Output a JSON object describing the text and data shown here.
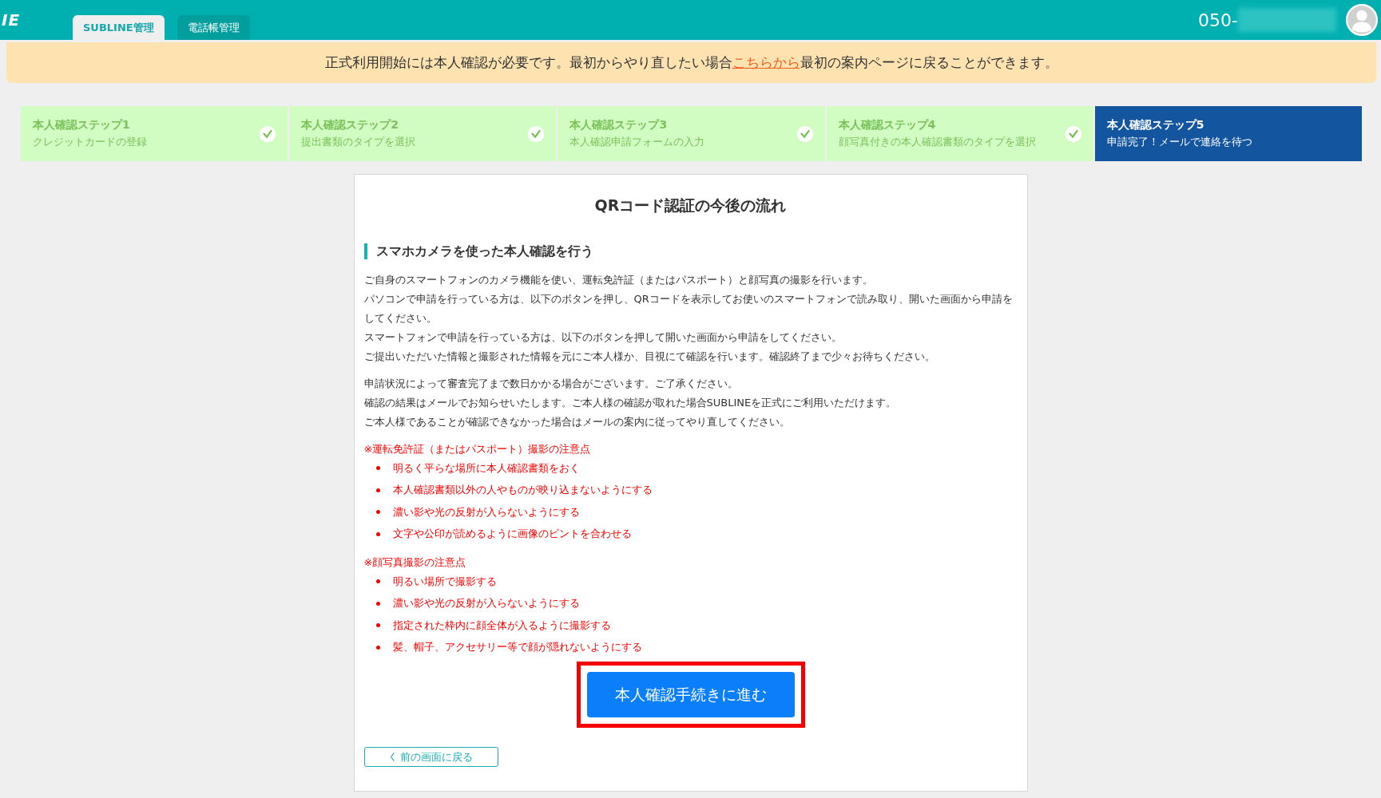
{
  "header": {
    "logo_text": "IE",
    "tabs": [
      {
        "label": "SUBLINE管理",
        "selected": true
      },
      {
        "label": "電話帳管理",
        "selected": false
      }
    ],
    "phone_number": "050-"
  },
  "notice": {
    "before": "正式利用開始には本人確認が必要です。最初からやり直したい場合",
    "link": "こちらから",
    "after": "最初の案内ページに戻ることができます。"
  },
  "steps": [
    {
      "title": "本人確認ステップ1",
      "subtitle": "クレジットカードの登録",
      "done": true,
      "selected": false
    },
    {
      "title": "本人確認ステップ2",
      "subtitle": "提出書類のタイプを選択",
      "done": true,
      "selected": false
    },
    {
      "title": "本人確認ステップ3",
      "subtitle": "本人確認申請フォームの入力",
      "done": true,
      "selected": false
    },
    {
      "title": "本人確認ステップ4",
      "subtitle": "顔写真付きの本人確認書類のタイプを選択",
      "done": true,
      "selected": false
    },
    {
      "title": "本人確認ステップ5",
      "subtitle": "申請完了！メールで連絡を待つ",
      "done": false,
      "selected": true
    }
  ],
  "card": {
    "title": "QRコード認証の今後の流れ",
    "section_heading": "スマホカメラを使った本人確認を行う",
    "paragraphs": [
      [
        "ご自身のスマートフォンのカメラ機能を使い、運転免許証（またはパスポート）と顔写真の撮影を行います。",
        "パソコンで申請を行っている方は、以下のボタンを押し、QRコードを表示してお使いのスマートフォンで読み取り、開いた画面から申請をしてください。",
        "スマートフォンで申請を行っている方は、以下のボタンを押して開いた画面から申請をしてください。",
        "ご提出いただいた情報と撮影された情報を元にご本人様か、目視にて確認を行います。確認終了まで少々お待ちください。"
      ],
      [
        "申請状況によって審査完了まで数日かかる場合がございます。ご了承ください。",
        "確認の結果はメールでお知らせいたします。ご本人様の確認が取れた場合SUBLINEを正式にご利用いただけます。",
        "ご本人様であることが確認できなかった場合はメールの案内に従ってやり直してください。"
      ]
    ],
    "cautions": [
      {
        "heading": "※運転免許証（またはパスポート）撮影の注意点",
        "items": [
          "明るく平らな場所に本人確認書類をおく",
          "本人確認書類以外の人やものが映り込まないようにする",
          "濃い影や光の反射が入らないようにする",
          "文字や公印が読めるように画像のピントを合わせる"
        ]
      },
      {
        "heading": "※顔写真撮影の注意点",
        "items": [
          "明るい場所で撮影する",
          "濃い影や光の反射が入らないようにする",
          "指定された枠内に顔全体が入るように撮影する",
          "髪、帽子、アクセサリー等で顔が隠れないようにする"
        ]
      }
    ],
    "primary_button": "本人確認手続きに進む",
    "back_button": "前の画面に戻る"
  }
}
